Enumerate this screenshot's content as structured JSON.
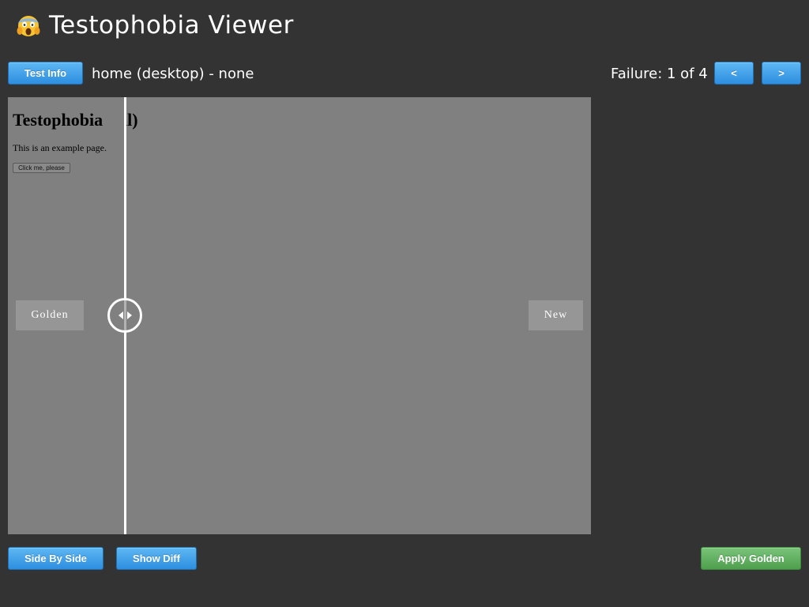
{
  "app": {
    "title": "Testophobia Viewer",
    "icon": "face-screaming-in-fear-icon"
  },
  "toolbar": {
    "test_info_label": "Test Info",
    "test_name": "home (desktop) - none",
    "failure_text": "Failure: 1 of 4",
    "prev_label": "<",
    "next_label": ">"
  },
  "viewer": {
    "golden_tag": "Golden",
    "new_tag": "New",
    "golden_page": {
      "heading": "Testophobia",
      "paragraph": "This is an example page.",
      "button": "Click me, please"
    },
    "new_page": {
      "heading_visible": "ail)"
    },
    "slider_position_percent": 20,
    "handle_icon": "left-right-arrows-icon"
  },
  "footer": {
    "side_by_side_label": "Side By Side",
    "show_diff_label": "Show Diff",
    "apply_golden_label": "Apply Golden"
  },
  "colors": {
    "background": "#333333",
    "viewer_bg": "#808080",
    "primary_button": "#2d8ee0",
    "success_button": "#4e9f4e"
  }
}
